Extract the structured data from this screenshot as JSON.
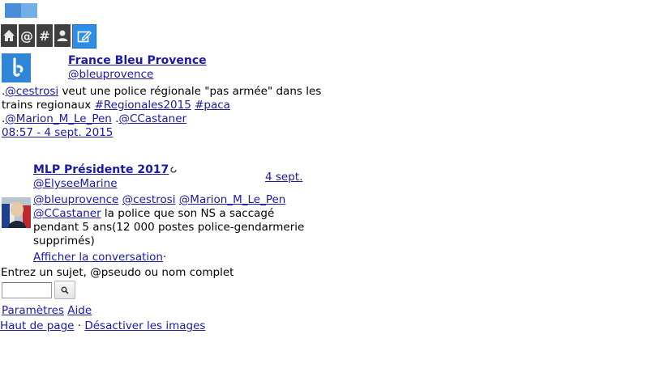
{
  "nav": {
    "icons": [
      "home-icon",
      "at-icon",
      "hash-icon",
      "profile-icon",
      "compose-icon"
    ],
    "at_glyph": "@",
    "hash_glyph": "#"
  },
  "tweet1": {
    "name": "France Bleu Provence",
    "handle": "@bleuprovence",
    "text_prefix": ".",
    "mention1": "@cestrosi",
    "text_mid": " veut une police régionale \"pas armée\" dans les trains regionaux ",
    "hashtag1": "#Regionales2015",
    "hashtag2": "#paca",
    "dot2": ".",
    "mention2": "@Marion_M_Le_Pen",
    "dot3": " .",
    "mention3": "@CCastaner",
    "time": "08:57 - 4 sept. 2015"
  },
  "tweet2": {
    "name": "MLP Présidente 2017",
    "handle": "@ElyseeMarine",
    "date": "4 sept.",
    "mentions": [
      "@bleuprovence",
      "@cestrosi",
      "@Marion_M_Le_Pen",
      "@CCastaner"
    ],
    "text": " la police que son NS a saccagé pendant 5 ans(12 000 postes police-gendarmerie supprimés)",
    "conversation_link": "Afficher la conversation",
    "conversation_sep": "·"
  },
  "search": {
    "label": "Entrez un sujet, @pseudo ou nom complet",
    "value": ""
  },
  "footer": {
    "settings": "Paramètres",
    "help": "Aide",
    "top": "Haut de page",
    "sep": "·",
    "disable_images": "Désactiver les images"
  },
  "colors": {
    "link": "#1a1aa6",
    "nav_bg": "#3f3f3f",
    "nav_active": "#2e8de4"
  }
}
